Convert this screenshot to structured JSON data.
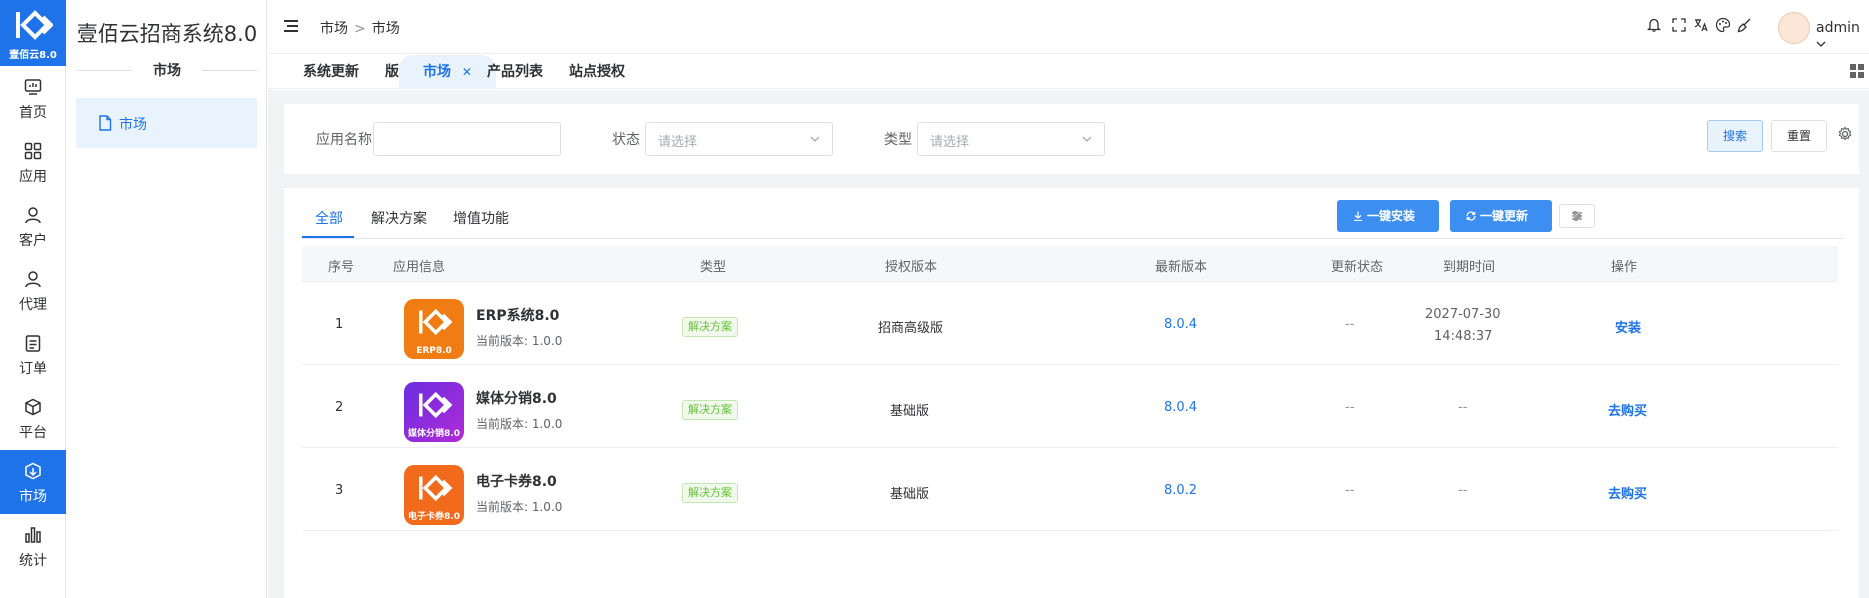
{
  "brand": {
    "logo_text": "壹佰云8.0",
    "accent": "#1e73e8"
  },
  "rail": [
    {
      "label": "首页",
      "icon": "monitor-icon"
    },
    {
      "label": "应用",
      "icon": "grid-icon"
    },
    {
      "label": "客户",
      "icon": "user-icon"
    },
    {
      "label": "代理",
      "icon": "user-icon"
    },
    {
      "label": "订单",
      "icon": "clipboard-icon"
    },
    {
      "label": "平台",
      "icon": "box-icon"
    },
    {
      "label": "市场",
      "icon": "box-download-icon",
      "active": true
    },
    {
      "label": "统计",
      "icon": "bar-chart-icon"
    }
  ],
  "sidebar": {
    "title": "壹佰云招商系统8.0",
    "section": "市场",
    "items": [
      {
        "label": "市场",
        "icon": "file-icon"
      }
    ]
  },
  "header": {
    "breadcrumb": [
      "市场",
      "市场"
    ],
    "separator": ">",
    "user": "admin"
  },
  "tabs": [
    {
      "label": "系统更新"
    },
    {
      "label": "版本销量"
    },
    {
      "label": "市场",
      "active": true
    },
    {
      "label": "产品列表"
    },
    {
      "label": "站点授权"
    }
  ],
  "filter": {
    "app_name_label": "应用名称",
    "app_name_value": "",
    "status_label": "状态",
    "status_placeholder": "请选择",
    "type_label": "类型",
    "type_placeholder": "请选择",
    "search_label": "搜索",
    "reset_label": "重置"
  },
  "panel": {
    "tabs": [
      "全部",
      "解决方案",
      "增值功能"
    ],
    "active_tab": "全部",
    "install_all_label": "一键安装",
    "update_all_label": "一键更新"
  },
  "table": {
    "columns": [
      "序号",
      "应用信息",
      "类型",
      "授权版本",
      "最新版本",
      "更新状态",
      "到期时间",
      "操作"
    ],
    "rows": [
      {
        "index": "1",
        "name": "ERP系统8.0",
        "current_version": "当前版本: 1.0.0",
        "icon_caption": "ERP8.0",
        "icon_color": "#f07d14",
        "type": "解决方案",
        "license": "招商高级版",
        "latest": "8.0.4",
        "update_status": "--",
        "expire_date": "2027-07-30",
        "expire_time": "14:48:37",
        "action": "安装"
      },
      {
        "index": "2",
        "name": "媒体分销8.0",
        "current_version": "当前版本: 1.0.0",
        "icon_caption": "媒体分销8.0",
        "icon_color": "#8a2be2",
        "type": "解决方案",
        "license": "基础版",
        "latest": "8.0.4",
        "update_status": "--",
        "expire_date": "--",
        "expire_time": "",
        "action": "去购买"
      },
      {
        "index": "3",
        "name": "电子卡券8.0",
        "current_version": "当前版本: 1.0.0",
        "icon_caption": "电子卡券8.0",
        "icon_color": "#f26b1d",
        "type": "解决方案",
        "license": "基础版",
        "latest": "8.0.2",
        "update_status": "--",
        "expire_date": "--",
        "expire_time": "",
        "action": "去购买"
      }
    ]
  }
}
